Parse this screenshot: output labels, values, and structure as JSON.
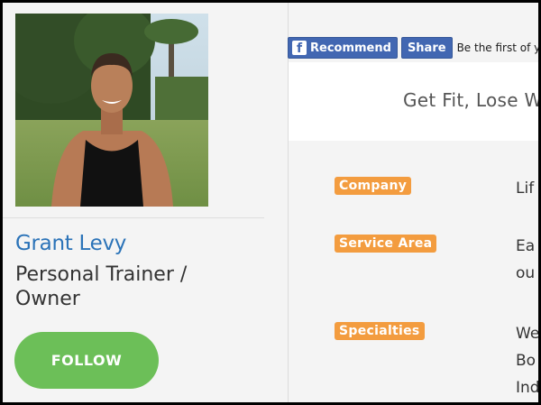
{
  "profile": {
    "name": "Grant Levy",
    "role": "Personal Trainer / Owner",
    "follow_label": "FOLLOW"
  },
  "facebook": {
    "recommend_label": "Recommend",
    "share_label": "Share",
    "social_text": "Be the first of yo"
  },
  "banner": {
    "tagline": "Get Fit, Lose W"
  },
  "details": {
    "company": {
      "label": "Company",
      "value_lines": [
        "Lif"
      ]
    },
    "service_area": {
      "label": "Service Area",
      "value_lines": [
        "Ea",
        "ou"
      ]
    },
    "specialties": {
      "label": "Specialties",
      "value_lines": [
        "We",
        "Bo",
        "Ind"
      ]
    }
  },
  "colors": {
    "accent_blue": "#2b73b8",
    "follow_green": "#6cbf58",
    "label_orange": "#f39c3f",
    "facebook_blue": "#4267b2"
  }
}
